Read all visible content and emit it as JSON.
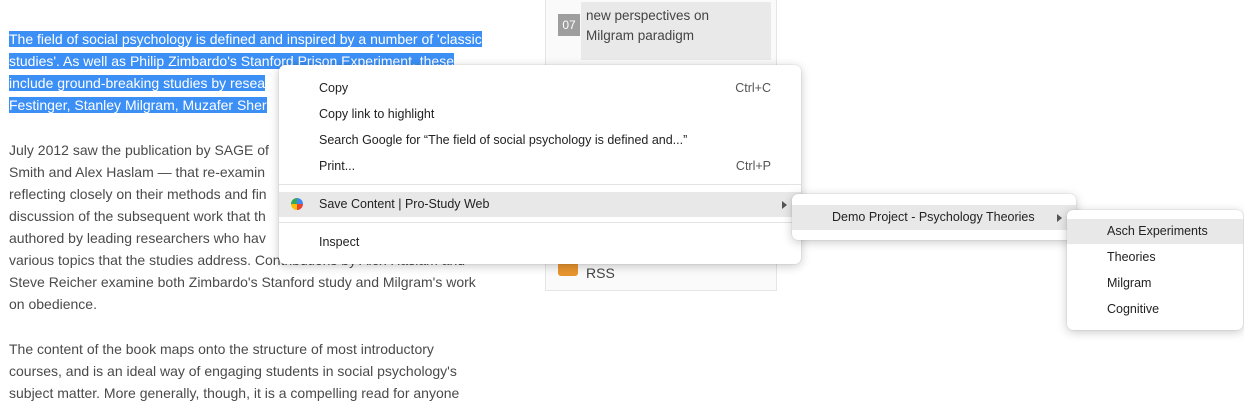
{
  "article": {
    "lines": [
      "The field of social psychology is defined and inspired by a number of 'classic",
      "studies'. As well as Philip Zimbardo's Stanford Prison Experiment, these",
      "include ground-breaking studies by resea",
      "Festinger, Stanley Milgram, Muzafer Sher",
      "July 2012 saw the publication by SAGE of",
      "Smith and Alex Haslam — that re-examin",
      "reflecting closely on their methods and fin",
      "discussion of the subsequent work that th",
      "authored by leading researchers who hav",
      "various topics that the studies address. Contributions by Alex Haslam and",
      "Steve Reicher examine both Zimbardo's Stanford study and Milgram's work",
      "on obedience.",
      "The content of the book maps onto the structure of most introductory",
      "courses, and is an ideal way of engaging students in social psychology's",
      "subject matter.  More generally, though, it is a compelling read for anyone"
    ]
  },
  "sidebar": {
    "item_number": "07",
    "item_line1": "new perspectives on",
    "item_line2": "Milgram paradigm",
    "rss_label": "RSS"
  },
  "context_menu": {
    "copy": "Copy",
    "copy_shortcut": "Ctrl+C",
    "copy_link": "Copy link to highlight",
    "search": "Search Google for “The field of social psychology is defined and...”",
    "print": "Print...",
    "print_shortcut": "Ctrl+P",
    "save_content": "Save Content | Pro-Study Web",
    "inspect": "Inspect"
  },
  "submenu": {
    "project": "Demo Project - Psychology Theories"
  },
  "submenu2": {
    "items": [
      "Asch Experiments",
      "Theories",
      "Milgram",
      "Cognitive"
    ]
  },
  "colors": {
    "selection": "#3b8ff5",
    "menu_hover": "#e8e8e8"
  }
}
